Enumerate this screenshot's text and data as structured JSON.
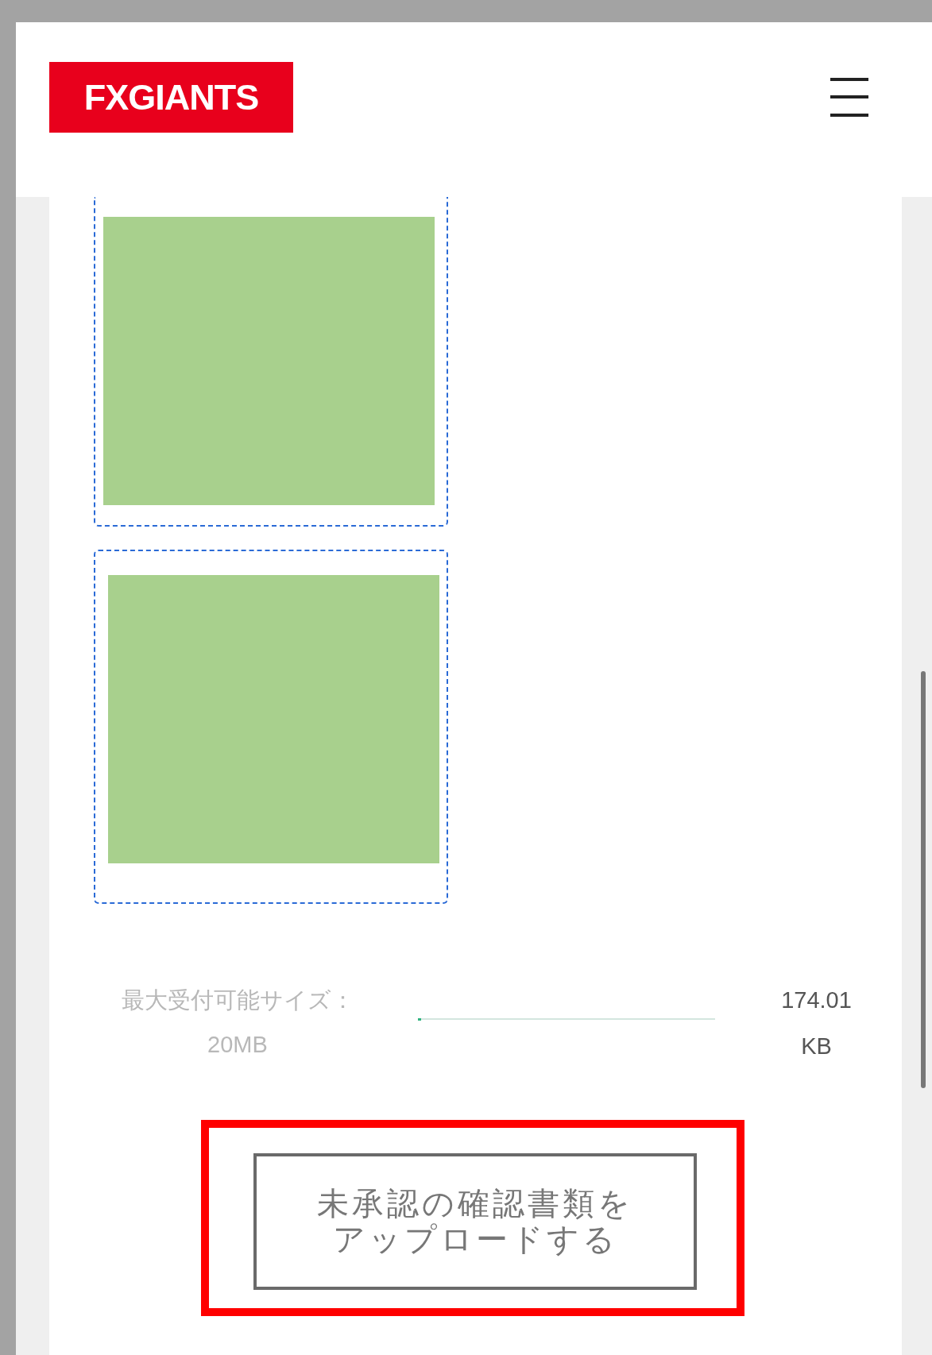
{
  "header": {
    "logo": "FXGIANTS"
  },
  "uploads": [
    {
      "kind": "image",
      "cut_top": true
    },
    {
      "kind": "image",
      "cut_top": false
    }
  ],
  "file_size": {
    "limit_label": "最大受付可能サイズ：",
    "limit_value": "20MB",
    "level": 0.01,
    "size_value": "174.01",
    "size_unit": "KB"
  },
  "upload_button": {
    "label": "未承認の確認書類をアップロードする"
  }
}
